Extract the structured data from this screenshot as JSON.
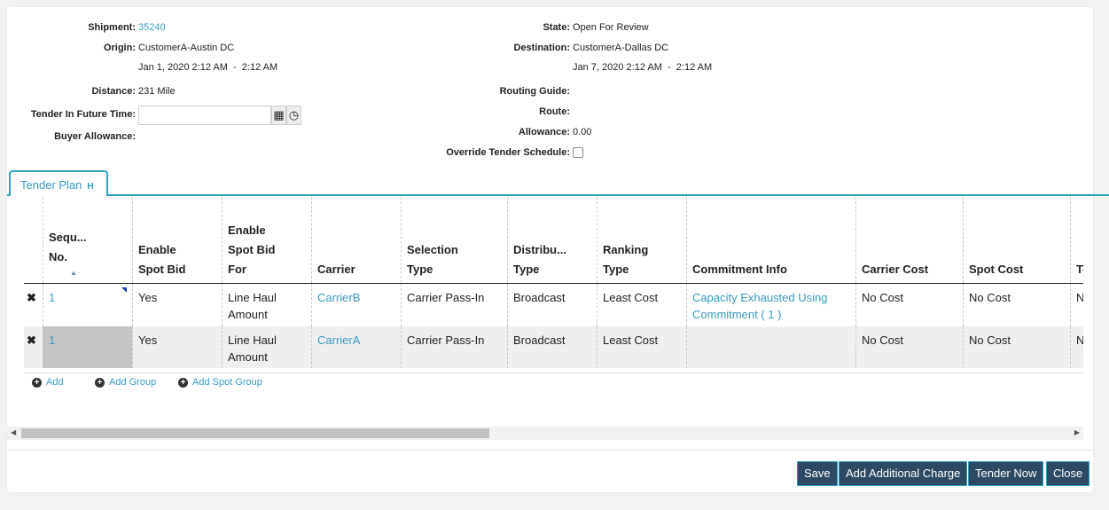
{
  "info": {
    "shipment_label": "Shipment:",
    "shipment": "35240",
    "origin_label": "Origin:",
    "origin": "CustomerA-Austin DC",
    "origin_time": "Jan 1, 2020 2:12 AM  -  2:12 AM",
    "distance_label": "Distance:",
    "distance": "231 Mile",
    "tender_future_label": "Tender In Future Time:",
    "tender_future_value": "",
    "buyer_allowance_label": "Buyer Allowance:",
    "state_label": "State:",
    "state": "Open For Review",
    "destination_label": "Destination:",
    "destination": "CustomerA-Dallas DC",
    "destination_time": "Jan 7, 2020 2:12 AM  -  2:12 AM",
    "routing_guide_label": "Routing Guide:",
    "route_label": "Route:",
    "allowance_label": "Allowance:",
    "allowance": "0.00",
    "override_label": "Override Tender Schedule:",
    "override_checked": false
  },
  "tab": {
    "label": "Tender Plan",
    "badge": "H"
  },
  "table": {
    "headers": [
      "Sequ...\nNo.",
      "Enable\nSpot Bid",
      "Enable\nSpot Bid\nFor",
      "Carrier",
      "Selection\nType",
      "Distribu...\nType",
      "Ranking\nType",
      "Commitment Info",
      "Carrier Cost",
      "Spot Cost",
      "To"
    ],
    "header_lines": {
      "seq": [
        "Sequ...",
        "No."
      ],
      "enable": [
        "Enable",
        "Spot Bid"
      ],
      "spotfor": [
        "Enable",
        "Spot Bid",
        "For"
      ],
      "carrier": "Carrier",
      "selection": [
        "Selection",
        "Type"
      ],
      "distrib": [
        "Distribu...",
        "Type"
      ],
      "ranking": [
        "Ranking",
        "Type"
      ],
      "commitment": "Commitment Info",
      "carrier_cost": "Carrier Cost",
      "spot_cost": "Spot Cost",
      "total": "To"
    },
    "rows": [
      {
        "seq": "1",
        "enable": "Yes",
        "spotfor": "Line Haul Amount",
        "carrier": "CarrierB",
        "selection": "Carrier Pass-In",
        "distrib": "Broadcast",
        "ranking": "Least Cost",
        "commitment": "Capacity Exhausted Using Commitment ( 1 )",
        "carrier_cost": "No Cost",
        "spot_cost": "No Cost",
        "total": "N"
      },
      {
        "seq": "1",
        "enable": "Yes",
        "spotfor": "Line Haul Amount",
        "carrier": "CarrierA",
        "selection": "Carrier Pass-In",
        "distrib": "Broadcast",
        "ranking": "Least Cost",
        "commitment": "",
        "carrier_cost": "No Cost",
        "spot_cost": "No Cost",
        "total": "N"
      }
    ]
  },
  "actions": {
    "add": "Add",
    "add_group": "Add Group",
    "add_spot_group": "Add Spot Group"
  },
  "buttons": {
    "save": "Save",
    "add_charge": "Add Additional Charge",
    "tender_now": "Tender Now",
    "close": "Close"
  }
}
